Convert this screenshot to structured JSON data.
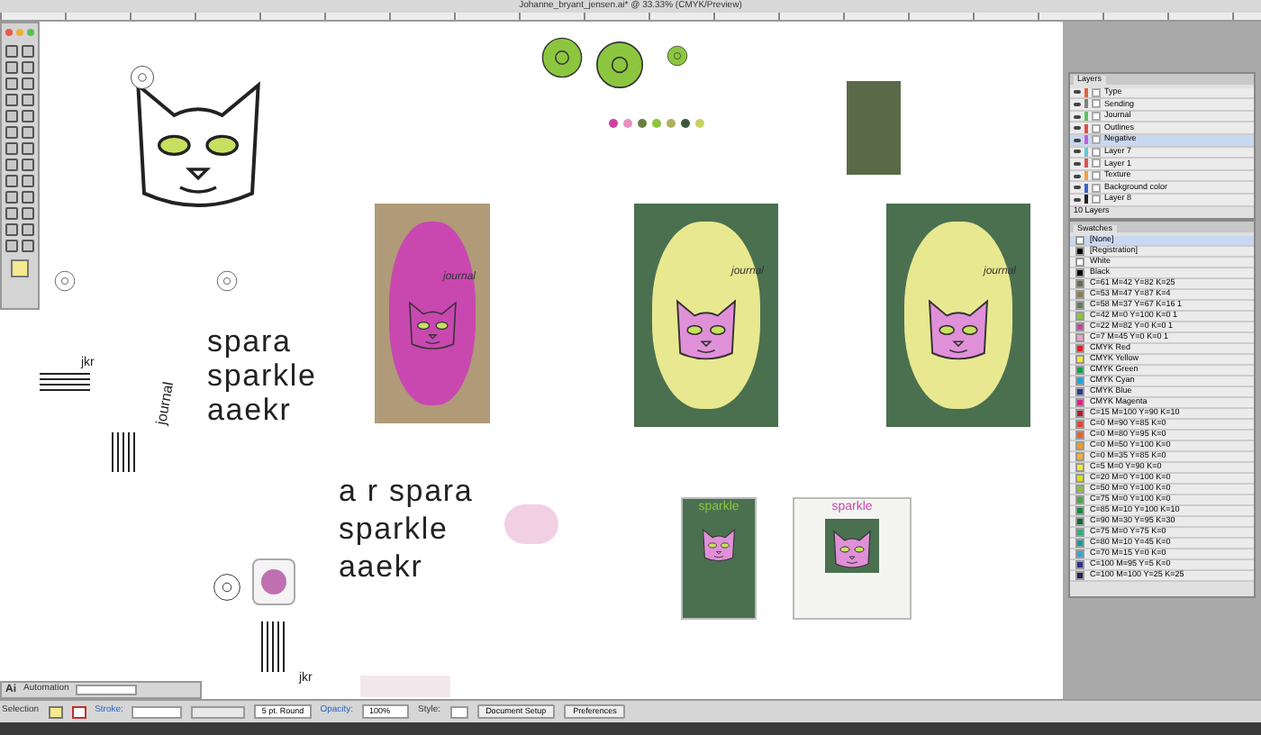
{
  "window": {
    "title": "Johanne_bryant_jensen.ai* @ 33.33% (CMYK/Preview)"
  },
  "canvas": {
    "lettering_left": [
      "spara",
      "sparkle",
      "aaekr"
    ],
    "lettering_right": [
      "a r spara",
      "sparkle",
      "aaekr"
    ],
    "initials": [
      "jkr",
      "jkr"
    ],
    "journal_tag": "journal",
    "card_labels": [
      "journal",
      "journal",
      "journal"
    ],
    "small_card_words": [
      "sparkle",
      "sparkle"
    ]
  },
  "layers_panel": {
    "tab": "Layers",
    "layers": [
      {
        "name": "Type",
        "color": "#e8603a",
        "selected": false
      },
      {
        "name": "Sending",
        "color": "#808080",
        "selected": false
      },
      {
        "name": "Journal",
        "color": "#60c060",
        "selected": false
      },
      {
        "name": "Outlines",
        "color": "#e05050",
        "selected": false
      },
      {
        "name": "Negative",
        "color": "#c060e0",
        "selected": true
      },
      {
        "name": "Layer 7",
        "color": "#60c8d0",
        "selected": false
      },
      {
        "name": "Layer 1",
        "color": "#e05050",
        "selected": false
      },
      {
        "name": "Texture",
        "color": "#f0a040",
        "selected": false
      },
      {
        "name": "Background color",
        "color": "#4060d0",
        "selected": false
      },
      {
        "name": "Layer 8",
        "color": "#202020",
        "selected": false
      }
    ],
    "footer": "10 Layers"
  },
  "swatches_panel": {
    "tab": "Swatches",
    "swatches": [
      {
        "name": "[None]",
        "color": "#ffffff",
        "selected": true
      },
      {
        "name": "[Registration]",
        "color": "#000000",
        "selected": false
      },
      {
        "name": "White",
        "color": "#ffffff",
        "selected": false
      },
      {
        "name": "Black",
        "color": "#000000",
        "selected": false
      },
      {
        "name": "C=61 M=42 Y=82 K=25",
        "color": "#6b6a45",
        "selected": false
      },
      {
        "name": "C=53 M=47 Y=87 K=4",
        "color": "#8a8050",
        "selected": false
      },
      {
        "name": "C=58 M=37 Y=67 K=16 1",
        "color": "#5e7a5a",
        "selected": false
      },
      {
        "name": "C=42 M=0 Y=100 K=0 1",
        "color": "#8cc63f",
        "selected": false
      },
      {
        "name": "C=22 M=82 Y=0 K=0 1",
        "color": "#c04a9a",
        "selected": false
      },
      {
        "name": "C=7 M=45 Y=0 K=0 1",
        "color": "#e6a0c8",
        "selected": false
      },
      {
        "name": "CMYK Red",
        "color": "#e0202a",
        "selected": false
      },
      {
        "name": "CMYK Yellow",
        "color": "#f5e82a",
        "selected": false
      },
      {
        "name": "CMYK Green",
        "color": "#10a04a",
        "selected": false
      },
      {
        "name": "CMYK Cyan",
        "color": "#10a8e0",
        "selected": false
      },
      {
        "name": "CMYK Blue",
        "color": "#2a3a90",
        "selected": false
      },
      {
        "name": "CMYK Magenta",
        "color": "#e0208a",
        "selected": false
      },
      {
        "name": "C=15 M=100 Y=90 K=10",
        "color": "#b01e2a",
        "selected": false
      },
      {
        "name": "C=0 M=90 Y=85 K=0",
        "color": "#e84030",
        "selected": false
      },
      {
        "name": "C=0 M=80 Y=95 K=0",
        "color": "#e8602a",
        "selected": false
      },
      {
        "name": "C=0 M=50 Y=100 K=0",
        "color": "#f39a1e",
        "selected": false
      },
      {
        "name": "C=0 M=35 Y=85 K=0",
        "color": "#f8b040",
        "selected": false
      },
      {
        "name": "C=5 M=0 Y=90 K=0",
        "color": "#f5ea30",
        "selected": false
      },
      {
        "name": "C=20 M=0 Y=100 K=0",
        "color": "#d8e020",
        "selected": false
      },
      {
        "name": "C=50 M=0 Y=100 K=0",
        "color": "#88c040",
        "selected": false
      },
      {
        "name": "C=75 M=0 Y=100 K=0",
        "color": "#40a848",
        "selected": false
      },
      {
        "name": "C=85 M=10 Y=100 K=10",
        "color": "#128a40",
        "selected": false
      },
      {
        "name": "C=90 M=30 Y=95 K=30",
        "color": "#0a6a38",
        "selected": false
      },
      {
        "name": "C=75 M=0 Y=75 K=0",
        "color": "#30b080",
        "selected": false
      },
      {
        "name": "C=80 M=10 Y=45 K=0",
        "color": "#10a09a",
        "selected": false
      },
      {
        "name": "C=70 M=15 Y=0 K=0",
        "color": "#3aa0d8",
        "selected": false
      },
      {
        "name": "C=100 M=95 Y=5 K=0",
        "color": "#2a3090",
        "selected": false
      },
      {
        "name": "C=100 M=100 Y=25 K=25",
        "color": "#28205a",
        "selected": false
      }
    ]
  },
  "app_bar": {
    "logo": "Ai",
    "workspace": "Automation"
  },
  "control_bar": {
    "selection_label": "Selection",
    "stroke_label": "Stroke:",
    "brush": "5 pt. Round",
    "opacity_label": "Opacity:",
    "opacity": "100%",
    "style_label": "Style:",
    "buttons": [
      "Document Setup",
      "Preferences"
    ]
  }
}
